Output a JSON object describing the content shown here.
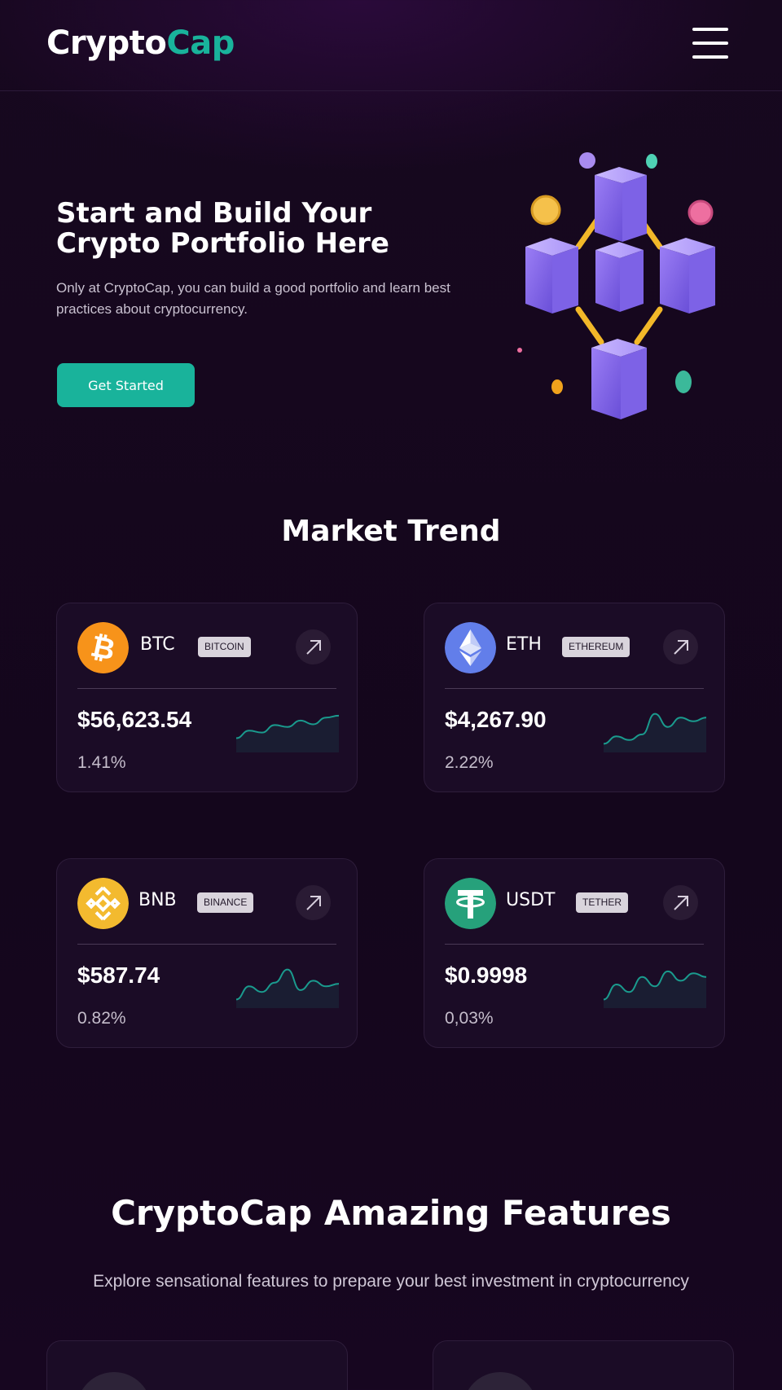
{
  "header": {
    "logo_part1": "Crypto",
    "logo_part2": "Cap",
    "menu_icon": "hamburger-menu-icon"
  },
  "hero": {
    "title": "Start and Build Your Crypto Portfolio Here",
    "subtitle": "Only at CryptoCap, you can build a good portfolio and learn best practices about cryptocurrency.",
    "cta_label": "Get Started",
    "illustration": "blockchain-cubes-illustration"
  },
  "market": {
    "title": "Market Trend",
    "cards": [
      {
        "ticker": "BTC",
        "name": "BITCOIN",
        "price": "$56,623.54",
        "change": "1.41%",
        "icon": "bitcoin-icon",
        "color": "#f7931a",
        "trend": [
          0.25,
          0.45,
          0.4,
          0.6,
          0.55,
          0.72,
          0.62,
          0.8,
          0.85
        ]
      },
      {
        "ticker": "ETH",
        "name": "ETHEREUM",
        "price": "$4,267.90",
        "change": "2.22%",
        "icon": "ethereum-icon",
        "color": "#627eea",
        "trend": [
          0.1,
          0.3,
          0.2,
          0.35,
          0.9,
          0.55,
          0.8,
          0.7,
          0.8
        ]
      },
      {
        "ticker": "BNB",
        "name": "BINANCE",
        "price": "$587.74",
        "change": "0.82%",
        "icon": "binance-icon",
        "color": "#f3ba2f",
        "trend": [
          0.1,
          0.45,
          0.3,
          0.55,
          0.9,
          0.35,
          0.6,
          0.45,
          0.52
        ]
      },
      {
        "ticker": "USDT",
        "name": "TETHER",
        "price": "$0.9998",
        "change": "0,03%",
        "icon": "tether-icon",
        "color": "#26a17b",
        "trend": [
          0.1,
          0.5,
          0.3,
          0.7,
          0.45,
          0.85,
          0.6,
          0.8,
          0.7
        ]
      }
    ]
  },
  "features": {
    "title": "CryptoCap Amazing Features",
    "subtitle": "Explore sensational features to prepare your best investment in cryptocurrency"
  },
  "colors": {
    "accent": "#19b39b",
    "background": "#150720",
    "card": "#1b0c26",
    "sparkline": "#1a9b8e"
  }
}
